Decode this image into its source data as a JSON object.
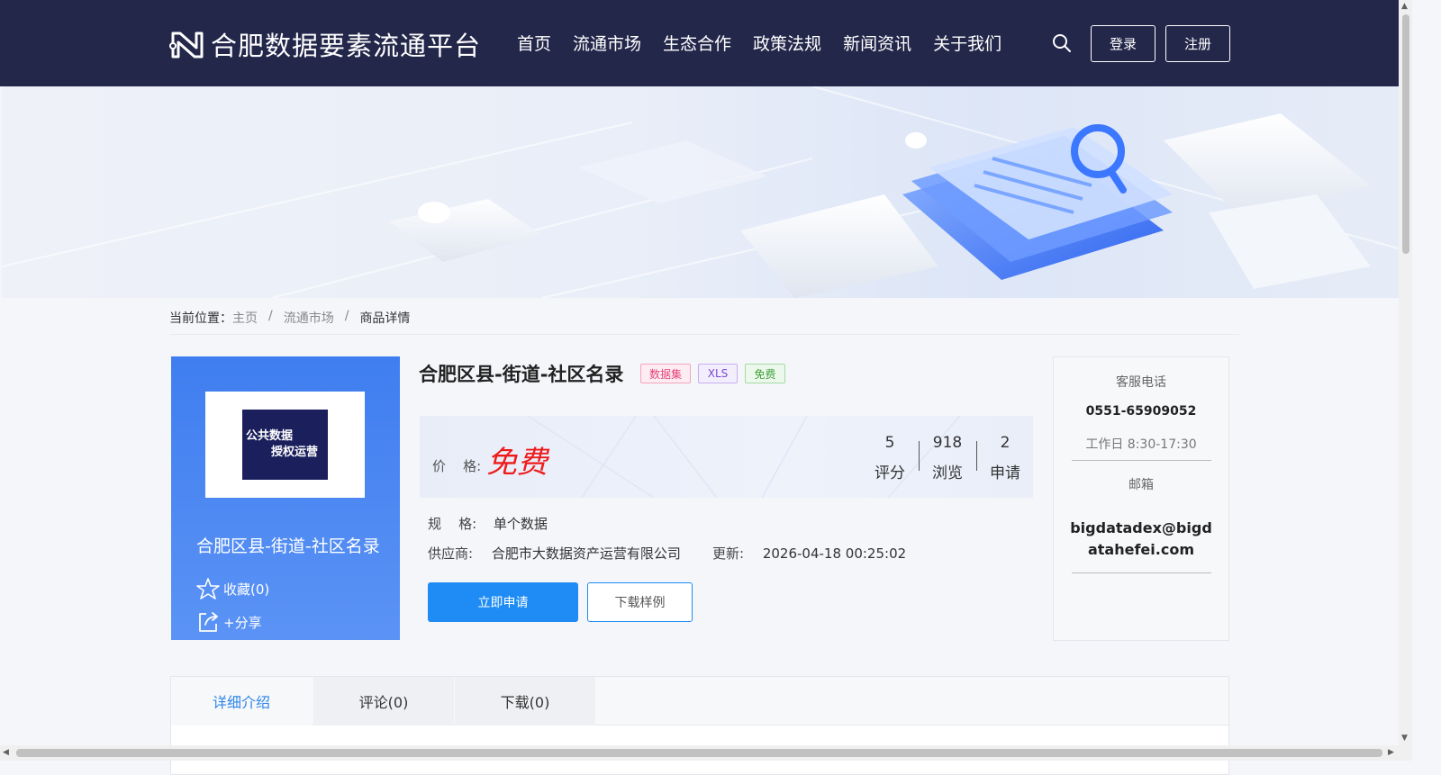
{
  "header": {
    "brand": "合肥数据要素流通平台",
    "nav": [
      "首页",
      "流通市场",
      "生态合作",
      "政策法规",
      "新闻资讯",
      "关于我们"
    ],
    "login": "登录",
    "register": "注册"
  },
  "breadcrumb": {
    "prefix": "当前位置：",
    "items": [
      "主页",
      "流通市场",
      "商品详情"
    ],
    "separator": "/"
  },
  "product_card": {
    "thumb_line1": "公共数据",
    "thumb_line2": "授权运营",
    "title": "合肥区县-街道-社区名录",
    "favorite": "收藏(0)",
    "share": "+分享"
  },
  "product": {
    "title": "合肥区县-街道-社区名录",
    "tags": [
      "数据集",
      "XLS",
      "免费"
    ],
    "price_label": "价    格:",
    "price": "免费",
    "stats": [
      {
        "value": "5",
        "label": "评分"
      },
      {
        "value": "918",
        "label": "浏览"
      },
      {
        "value": "2",
        "label": "申请"
      }
    ],
    "spec_label": "规    格:",
    "spec_value": "单个数据",
    "supplier_label": "供应商:",
    "supplier_value": "合肥市大数据资产运营有限公司",
    "update_label": "更新:",
    "update_value": "2026-04-18 00:25:02",
    "apply_button": "立即申请",
    "sample_button": "下载样例"
  },
  "service": {
    "phone_label": "客服电话",
    "phone": "0551-65909052",
    "hours": "工作日 8:30-17:30",
    "email_label": "邮箱",
    "email": "bigdatadex@bigdatahefei.com"
  },
  "tabs": [
    "详细介绍",
    "评论(0)",
    "下载(0)"
  ],
  "colors": {
    "header_bg": "#23274a",
    "accent_blue": "#1e8cf4",
    "price_red": "#ee1b1b",
    "card_blue": "#3f7ef0"
  }
}
